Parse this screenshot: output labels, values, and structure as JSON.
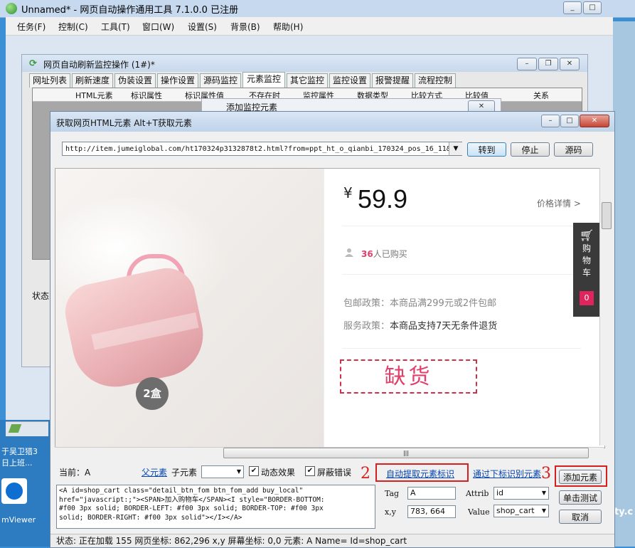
{
  "main_window": {
    "title": "Unnamed* - 网页自动操作通用工具 7.1.0.0 已注册",
    "menu": [
      "任务(F)",
      "控制(C)",
      "工具(T)",
      "窗口(W)",
      "设置(S)",
      "背景(B)",
      "帮助(H)"
    ]
  },
  "monitor_window": {
    "title": "网页自动刷新监控操作 (1#)*",
    "tabs": [
      "网址列表",
      "刷新速度",
      "伪装设置",
      "操作设置",
      "源码监控",
      "元素监控",
      "其它监控",
      "监控设置",
      "报警提醒",
      "流程控制"
    ],
    "active_tab": "元素监控",
    "columns": [
      "HTML元素",
      "标识属性",
      "标识属性值",
      "不存在时",
      "监控属性",
      "数据类型",
      "比较方式",
      "比较值",
      "关系"
    ],
    "add_dialog_title": "添加监控元素",
    "status_label": "状态"
  },
  "dialog": {
    "title": "获取网页HTML元素 Alt+T获取元素",
    "url": "http://item.jumeiglobal.com/ht170324p3132878t2.html?from=ppt_ht_o_qianbi_170324_pos_16_11&",
    "go_button": "转到",
    "stop_button": "停止",
    "source_button": "源码",
    "webpage": {
      "currency": "¥",
      "price": "59.9",
      "price_detail": "价格详情 >",
      "buyer_count": "36",
      "buyer_suffix": "人已购买",
      "shipping_label": "包邮政策：",
      "shipping_text": "本商品满299元或2件包邮",
      "service_label": "服务政策：",
      "service_text": "本商品支持7天无条件退货",
      "out_of_stock": "缺货",
      "cart_label": [
        "购",
        "物",
        "车"
      ],
      "cart_count": "0",
      "badge": "2盒"
    },
    "current_label": "当前：A",
    "parent_link": "父元素",
    "child_label": "子元素",
    "dynamic_label": "动态效果",
    "shield_error_label": "屏蔽错误",
    "auto_extract_link": "自动提取元素标识",
    "identify_link": "通过下标识别元素",
    "add_button": "添加元素",
    "test_button": "单击测试",
    "cancel_button": "取消",
    "tag_label": "Tag",
    "tag_value": "A",
    "xy_label": "x,y",
    "xy_value": "783, 664",
    "attrib_label": "Attrib",
    "attrib_value": "id",
    "value_label": "Value",
    "value_value": "shop_cart",
    "code": "<A id=shop_cart class=\"detail_btn_fom btn_fom_add buy_local\"\nhref=\"javascript:;\"><SPAN>加入购物车</SPAN><I style=\"BORDER-BOTTOM:\n#f00 3px solid; BORDER-LEFT: #f00 3px solid; BORDER-TOP: #f00 3px\nsolid; BORDER-RIGHT: #f00 3px solid\"></I></A>",
    "status": "状态:  正在加载  155  网页坐标:  862,296  x,y  屏幕坐标:  0,0  元素:  A Name= Id=shop_cart",
    "annotations": [
      "2",
      "3"
    ]
  },
  "desktop": {
    "icon_label_1": "于吴卫猎3",
    "icon_label_2": "日上班...",
    "icon_label_3": "mViewer",
    "right_text": "ty.c"
  }
}
